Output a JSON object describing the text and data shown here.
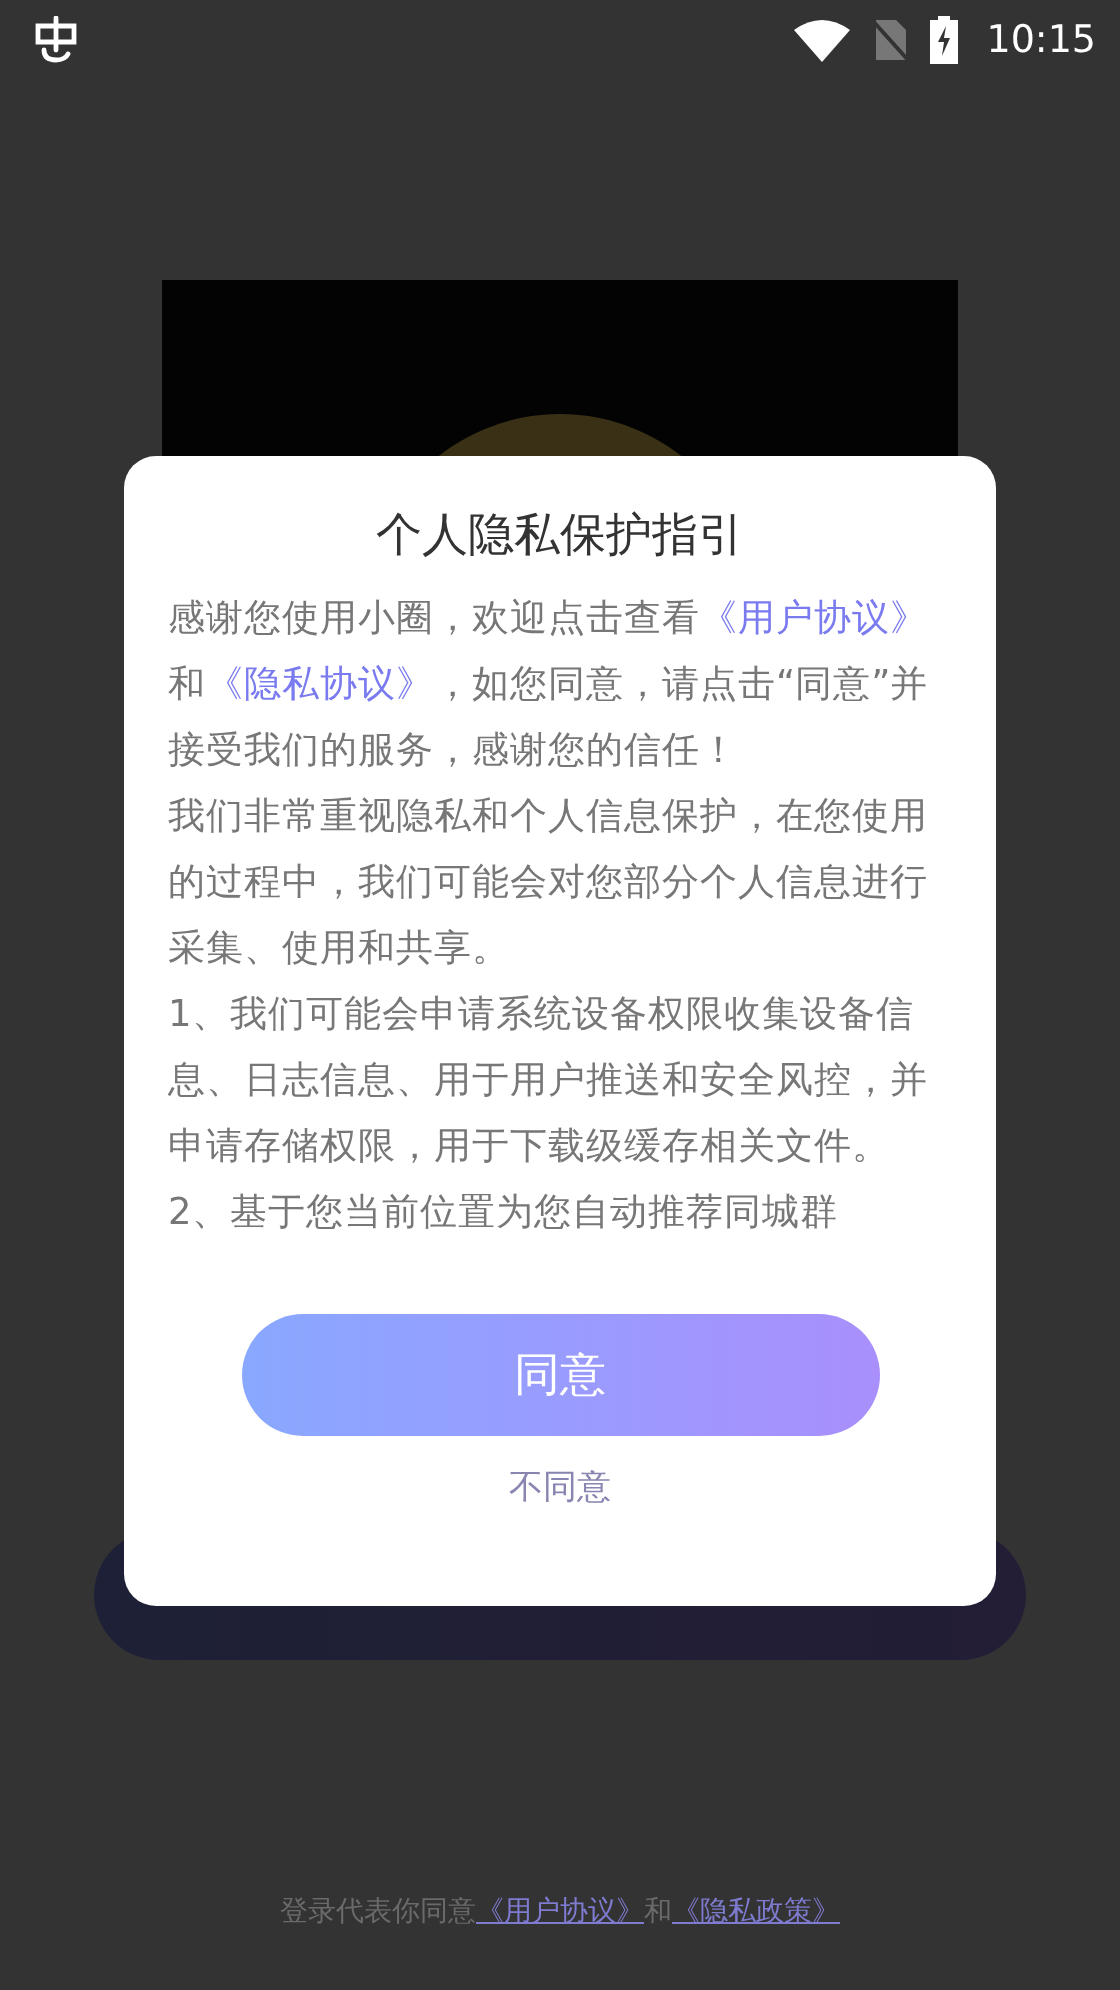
{
  "status_bar": {
    "time": "10:15"
  },
  "dialog": {
    "title": "个人隐私保护指引",
    "paragraphs": [
      [
        {
          "text": "感谢您使用小圈，欢迎点击查看",
          "link": false
        },
        {
          "text": "《用户协议》",
          "link": true
        },
        {
          "text": "和",
          "link": false
        },
        {
          "text": "《隐私协议》",
          "link": true
        },
        {
          "text": "，如您同意，请点击“同意”并接受我们的服务，感谢您的信任！",
          "link": false
        }
      ],
      [
        {
          "text": "我们非常重视隐私和个人信息保护，在您使用的过程中，我们可能会对您部分个人信息进行采集、使用和共享。",
          "link": false
        }
      ],
      [
        {
          "text": "1、我们可能会申请系统设备权限收集设备信息、日志信息、用于用户推送和安全风控，并申请存储权限，用于下载级缓存相关文件。",
          "link": false
        }
      ],
      [
        {
          "text": "2、基于您当前位置为您自动推荐同城群",
          "link": false
        }
      ]
    ],
    "agree_button": "同意",
    "disagree_button": "不同意"
  },
  "footer": [
    {
      "text": "登录代表你同意",
      "link": false
    },
    {
      "text": "《用户协议》",
      "link": true
    },
    {
      "text": "和",
      "link": false
    },
    {
      "text": "《隐私政策》",
      "link": true
    }
  ]
}
